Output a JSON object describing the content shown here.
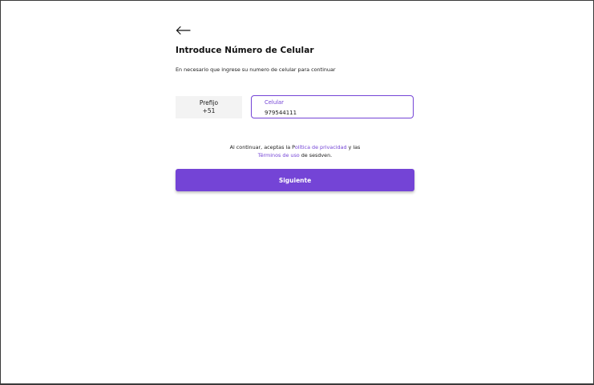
{
  "header": {
    "back_icon": "arrow-left-icon",
    "title": "Introduce Número de Celular",
    "subtitle": "En necesario que ingrese su numero  de celular para continuar"
  },
  "form": {
    "prefix_label": "Prefijo",
    "prefix_value": "+51",
    "phone_label": "Celular",
    "phone_value": "979544111"
  },
  "terms": {
    "text_before": "Al continuar, aceptas la P",
    "privacy_link": "olítica de privacidad",
    "text_middle": " y las",
    "terms_link": "Términos de uso",
    "text_after": " de sesdven."
  },
  "actions": {
    "next_label": "Siguiente"
  },
  "colors": {
    "accent": "#7444d6",
    "prefix_background": "#f3f3f3"
  }
}
